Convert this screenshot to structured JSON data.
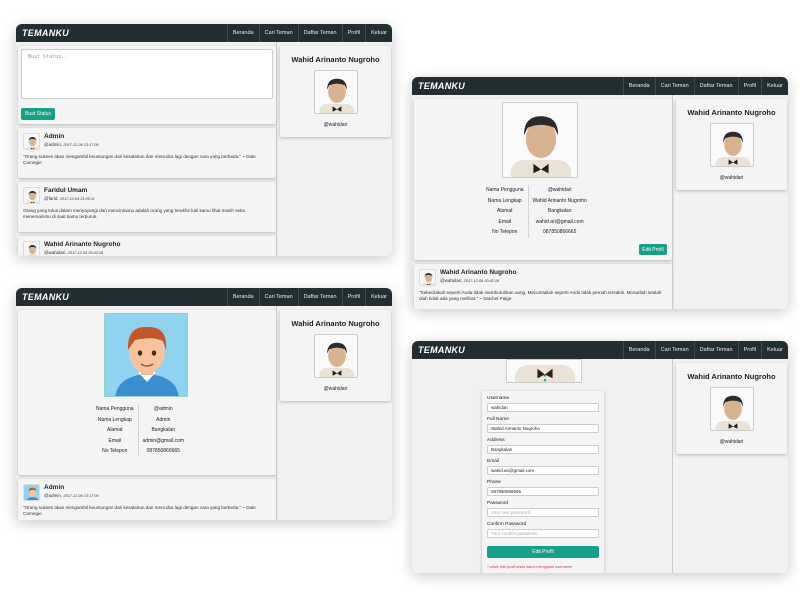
{
  "nav": {
    "brand": "TEMANKU",
    "items": [
      "Beranda",
      "Cari Teman",
      "Daftar Teman",
      "Profil",
      "Keluar"
    ]
  },
  "sidebar_profile": {
    "name": "Wahid Arinanto Nugroho",
    "username": "@wahidari"
  },
  "home": {
    "status_placeholder": "Buat Status..",
    "status_button": "Buat Status",
    "posts": [
      {
        "name": "Admin",
        "handle": "@admin,",
        "date": "2017-12-06 13:17:00",
        "text": "\"Orang sukses akan mengambil keuntungan dari kesalahan dan mencoba lagi dengan cara yang berbeda.\" ~ Dale Carnegie"
      },
      {
        "name": "Faridul Umam",
        "handle": "@farid,",
        "date": "2017-12-09 21:00:11",
        "text": "Orang yang tulus dalam menyayangi dan mencintaimu adalah orang yang terakhir kali kamu lihat masih setia menemanimu di saat kamu terpuruk."
      },
      {
        "name": "Wahid Arinanto Nugroho",
        "handle": "@wahidari,",
        "date": "2017-12-09 20:42:16",
        "text": ""
      }
    ]
  },
  "friend_profile": {
    "rows": [
      {
        "label": "Nama Pengguna",
        "value": "@admin"
      },
      {
        "label": "Nama Lengkap",
        "value": "Admin"
      },
      {
        "label": "Alamat",
        "value": "Bangkalan"
      },
      {
        "label": "Email",
        "value": "admin@gmail.com"
      },
      {
        "label": "No Telepon",
        "value": "087850866665"
      }
    ],
    "post": {
      "name": "Admin",
      "handle": "@admin,",
      "date": "2017-12-06 13:17:00",
      "text": "\"Orang sukses akan mengambil keuntungan dari kesalahan dan mencoba lagi dengan cara yang berbeda.\" ~ Dale Carnegie"
    }
  },
  "my_profile": {
    "rows": [
      {
        "label": "Nama Pengguna",
        "value": "@wahidari"
      },
      {
        "label": "Nama Lengkap",
        "value": "Wahid Arinanto Nugroho"
      },
      {
        "label": "Alamat",
        "value": "Bangkalan"
      },
      {
        "label": "Email",
        "value": "wahid.ari@gmail.com"
      },
      {
        "label": "No Telepon",
        "value": "087850866665"
      }
    ],
    "edit_button": "Edit Profil",
    "post": {
      "name": "Wahid Arinanto Nugroho",
      "handle": "@wahidari,",
      "date": "2017-12-09 20:42:16",
      "text": "\"Sekecilakah seperti Anda tidak membutuhkan uang. Mencintailah seperti Anda tidak pernah tersakiti. Menarilah seolah olah tidak ada yang melihat.\" ~ Satchel Paige"
    }
  },
  "edit_profile": {
    "username_label": "Username",
    "username_value": "wahidari",
    "fullname_label": "Full Name",
    "fullname_value": "Wahid Arinanto Nugroho",
    "address_label": "Address",
    "address_value": "Bangkalan",
    "email_label": "Email",
    "email_value": "wahid.ari@gmail.com",
    "phone_label": "Phone",
    "phone_value": "087850866665",
    "password_label": "Password",
    "password_placeholder": "Your new password..",
    "confirm_label": "Confirm Password",
    "confirm_placeholder": "Your confirm password..",
    "submit": "Edit Profil",
    "note": "* untuk edit profil anda harus mengganti username"
  }
}
